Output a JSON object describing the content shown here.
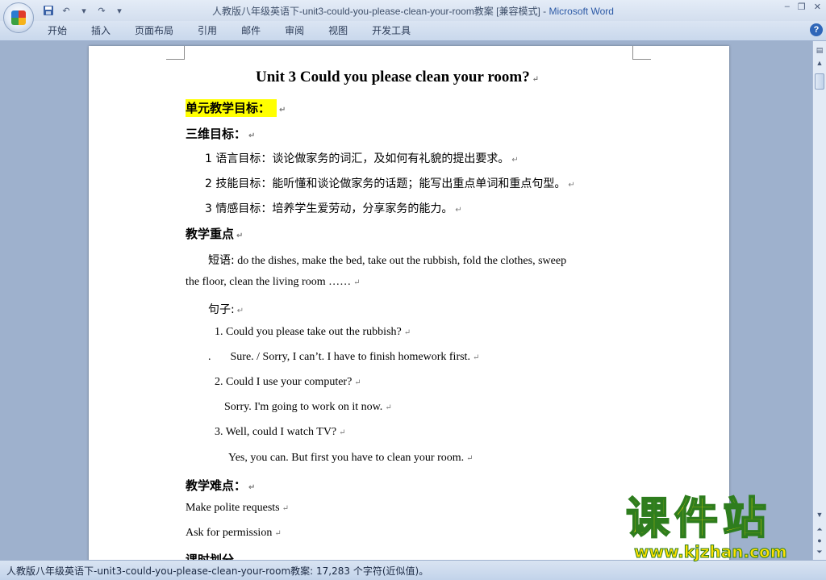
{
  "window": {
    "title": "人教版八年级英语下-unit3-could-you-please-clean-your-room教案 [兼容模式]",
    "separator": " - ",
    "app_name": "Microsoft Word",
    "minimize": "–",
    "restore": "❐",
    "close": "✕"
  },
  "quick_access": {
    "undo": "↶",
    "undo_arrow": "▾",
    "redo": "↷",
    "customize": "▾"
  },
  "ribbon": {
    "tabs": [
      "开始",
      "插入",
      "页面布局",
      "引用",
      "邮件",
      "审阅",
      "视图",
      "开发工具"
    ],
    "help": "?"
  },
  "document": {
    "title": "Unit 3 Could you please clean your room?",
    "unit_goals_heading": "单元教学目标：",
    "three_dim_heading": "三维目标：",
    "goal1": "1 语言目标：谈论做家务的词汇，及如何有礼貌的提出要求。",
    "goal2": "2  技能目标：能听懂和谈论做家务的话题；能写出重点单词和重点句型。",
    "goal3": "3  情感目标：培养学生爱劳动，分享家务的能力。",
    "key_points_heading": "教学重点",
    "phrases_label": "短语:",
    "phrases_line1": " do the dishes, make the bed, take out the rubbish, fold the clothes, sweep",
    "phrases_line2": "the floor, clean the living  room  ……",
    "sentences_label": "句子:",
    "s1": "1. Could you please take out the rubbish?",
    "s1_dot": ".",
    "s1_answer": "Sure. / Sorry, I can’t. I have to finish homework first.",
    "s2": "2. Could I use your computer?",
    "s2_answer": "Sorry. I'm going to work on it now.",
    "s3": "3. Well, could I watch TV?",
    "s3_answer": "Yes, you can. But first you have to clean your room.",
    "difficulties_heading": "教学难点：",
    "diff1": "Make polite requests",
    "diff2": "Ask for permission",
    "class_hours_heading": "课时划分",
    "para_mark": "↵"
  },
  "status_bar": {
    "text": "人教版八年级英语下-unit3-could-you-please-clean-your-room教案: 17,283 个字符(近似值)。"
  },
  "watermark": {
    "cn": "课件站",
    "url": "www.kjzhan.com"
  },
  "scrollbar": {
    "up": "▲",
    "down": "▼"
  }
}
